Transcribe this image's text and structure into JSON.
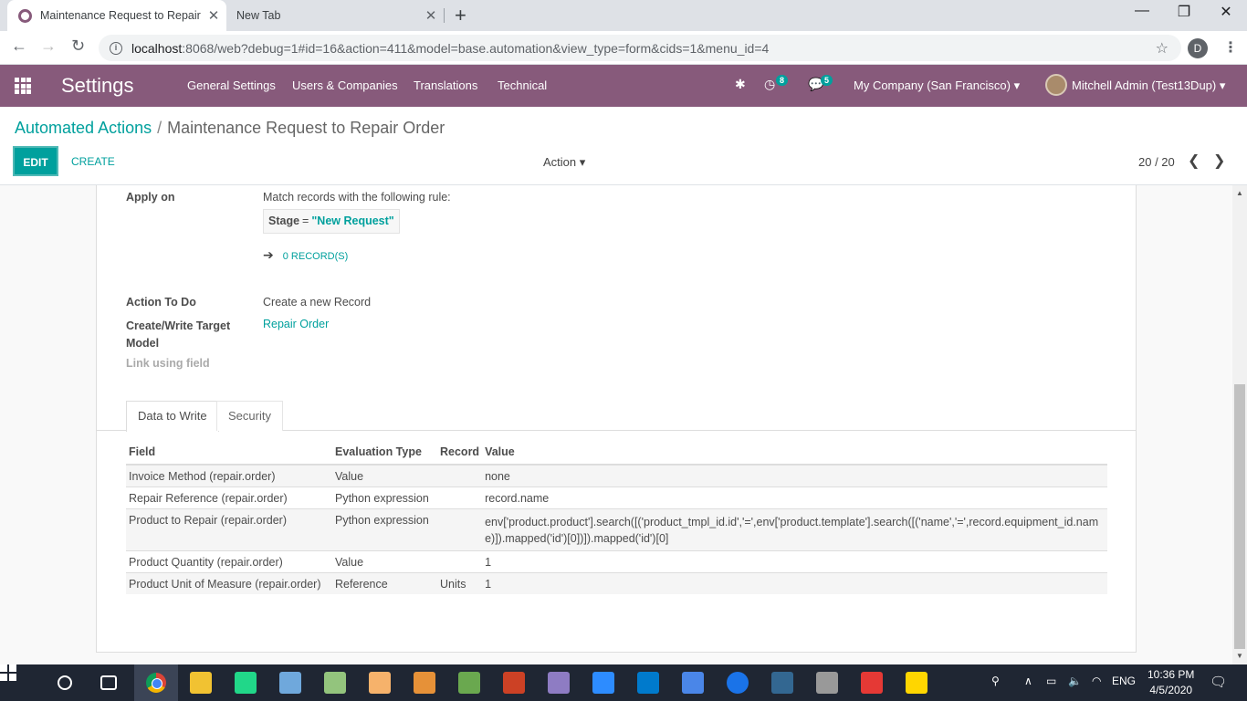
{
  "browser": {
    "tabs": [
      {
        "title": "Maintenance Request to Repair Or"
      },
      {
        "title": "New Tab"
      }
    ],
    "url_host": "localhost",
    "url_rest": ":8068/web?debug=1#id=16&action=411&model=base.automation&view_type=form&cids=1&menu_id=4",
    "profile_initial": "D"
  },
  "navbar": {
    "brand": "Settings",
    "menus": [
      "General Settings",
      "Users & Companies",
      "Translations",
      "Technical"
    ],
    "activity_count": "8",
    "messages_count": "5",
    "company": "My Company (San Francisco)",
    "user": "Mitchell Admin (Test13Dup)",
    "accent": "#875a7b"
  },
  "control_panel": {
    "breadcrumb_parent": "Automated Actions",
    "breadcrumb_current": "Maintenance Request to Repair Order",
    "edit_label": "EDIT",
    "create_label": "CREATE",
    "action_label": "Action",
    "pager": "20 / 20"
  },
  "form": {
    "apply_on_label": "Apply on",
    "apply_on_text": "Match records with the following rule:",
    "domain_field": "Stage",
    "domain_operator": "=",
    "domain_value": "\"New Request\"",
    "records_link": "0 RECORD(S)",
    "action_to_do_label": "Action To Do",
    "action_to_do_value": "Create a new Record",
    "target_model_label": "Create/Write Target Model",
    "target_model_value": "Repair Order",
    "link_field_label": "Link using field"
  },
  "tabs": {
    "data_to_write": "Data to Write",
    "security": "Security"
  },
  "table": {
    "headers": [
      "Field",
      "Evaluation Type",
      "Record",
      "Value"
    ],
    "rows": [
      [
        "Invoice Method (repair.order)",
        "Value",
        "",
        "none"
      ],
      [
        "Repair Reference (repair.order)",
        "Python expression",
        "",
        "record.name"
      ],
      [
        "Product to Repair (repair.order)",
        "Python expression",
        "",
        "env['product.product'].search([('product_tmpl_id.id','=',env['product.template'].search([('name','=',record.equipment_id.name)]).mapped('id')[0])]).mapped('id')[0]"
      ],
      [
        "Product Quantity (repair.order)",
        "Value",
        "",
        "1"
      ],
      [
        "Product Unit of Measure (repair.order)",
        "Reference",
        "Units",
        "1"
      ]
    ]
  },
  "taskbar": {
    "language": "ENG",
    "time": "10:36 PM",
    "date": "4/5/2020"
  }
}
